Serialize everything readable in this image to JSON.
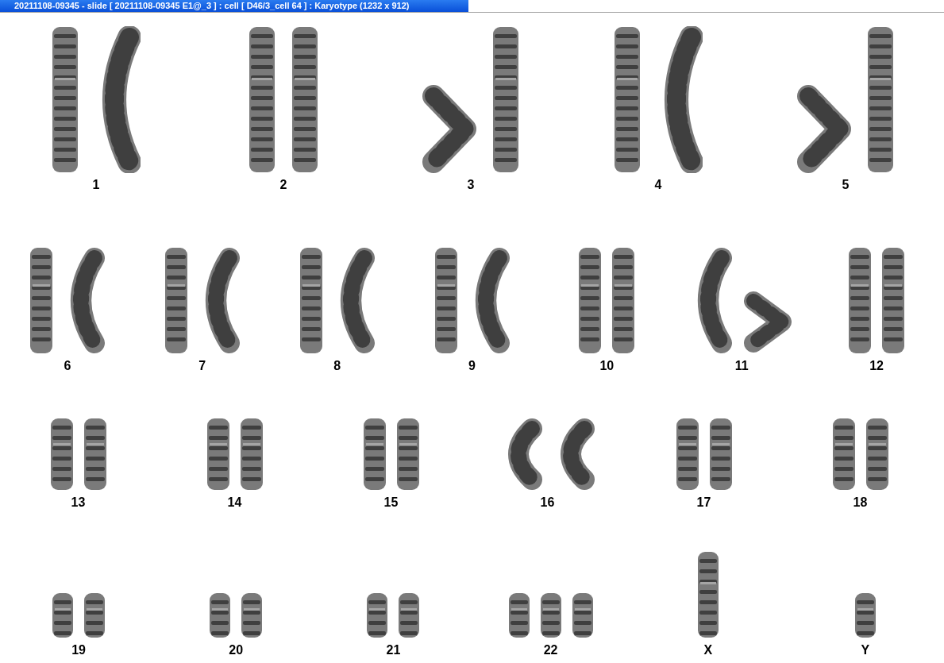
{
  "window": {
    "title": "20211108-09345 - slide [ 20211108-09345 E1@_3 ] : cell [ D46/3_cell 64 ] : Karyotype  (1232 x 912)"
  },
  "rows": [
    {
      "groups": [
        {
          "label": "1",
          "chromosomes": [
            {
              "kind": "straight"
            },
            {
              "kind": "bent"
            }
          ]
        },
        {
          "label": "2",
          "chromosomes": [
            {
              "kind": "straight"
            },
            {
              "kind": "straight"
            }
          ]
        },
        {
          "label": "3",
          "chromosomes": [
            {
              "kind": "folded"
            },
            {
              "kind": "straight"
            }
          ]
        },
        {
          "label": "4",
          "chromosomes": [
            {
              "kind": "straight"
            },
            {
              "kind": "bent"
            }
          ]
        },
        {
          "label": "5",
          "chromosomes": [
            {
              "kind": "folded"
            },
            {
              "kind": "straight"
            }
          ]
        }
      ]
    },
    {
      "groups": [
        {
          "label": "6",
          "chromosomes": [
            {
              "kind": "straight"
            },
            {
              "kind": "bent"
            }
          ]
        },
        {
          "label": "7",
          "chromosomes": [
            {
              "kind": "straight"
            },
            {
              "kind": "bent"
            }
          ]
        },
        {
          "label": "8",
          "chromosomes": [
            {
              "kind": "straight"
            },
            {
              "kind": "bent"
            }
          ]
        },
        {
          "label": "9",
          "chromosomes": [
            {
              "kind": "straight"
            },
            {
              "kind": "bent"
            }
          ]
        },
        {
          "label": "10",
          "chromosomes": [
            {
              "kind": "straight"
            },
            {
              "kind": "straight"
            }
          ]
        },
        {
          "label": "11",
          "chromosomes": [
            {
              "kind": "bent"
            },
            {
              "kind": "folded"
            }
          ]
        },
        {
          "label": "12",
          "chromosomes": [
            {
              "kind": "straight"
            },
            {
              "kind": "straight"
            }
          ]
        }
      ]
    },
    {
      "groups": [
        {
          "label": "13",
          "chromosomes": [
            {
              "kind": "straight"
            },
            {
              "kind": "straight"
            }
          ]
        },
        {
          "label": "14",
          "chromosomes": [
            {
              "kind": "straight"
            },
            {
              "kind": "straight"
            }
          ]
        },
        {
          "label": "15",
          "chromosomes": [
            {
              "kind": "straight"
            },
            {
              "kind": "straight"
            }
          ]
        },
        {
          "label": "16",
          "chromosomes": [
            {
              "kind": "bent"
            },
            {
              "kind": "bent"
            }
          ]
        },
        {
          "label": "17",
          "chromosomes": [
            {
              "kind": "straight"
            },
            {
              "kind": "straight"
            }
          ]
        },
        {
          "label": "18",
          "chromosomes": [
            {
              "kind": "straight"
            },
            {
              "kind": "straight"
            }
          ]
        }
      ]
    },
    {
      "groups": [
        {
          "label": "19",
          "chromosomes": [
            {
              "kind": "straight"
            },
            {
              "kind": "straight"
            }
          ]
        },
        {
          "label": "20",
          "chromosomes": [
            {
              "kind": "straight"
            },
            {
              "kind": "straight"
            }
          ]
        },
        {
          "label": "21",
          "chromosomes": [
            {
              "kind": "straight"
            },
            {
              "kind": "straight"
            }
          ]
        },
        {
          "label": "22",
          "chromosomes": [
            {
              "kind": "straight"
            },
            {
              "kind": "straight"
            },
            {
              "kind": "straight"
            }
          ]
        },
        {
          "label": "X",
          "chromosomes": [
            {
              "kind": "long"
            }
          ]
        },
        {
          "label": "Y",
          "chromosomes": [
            {
              "kind": "straight"
            }
          ]
        }
      ]
    }
  ]
}
